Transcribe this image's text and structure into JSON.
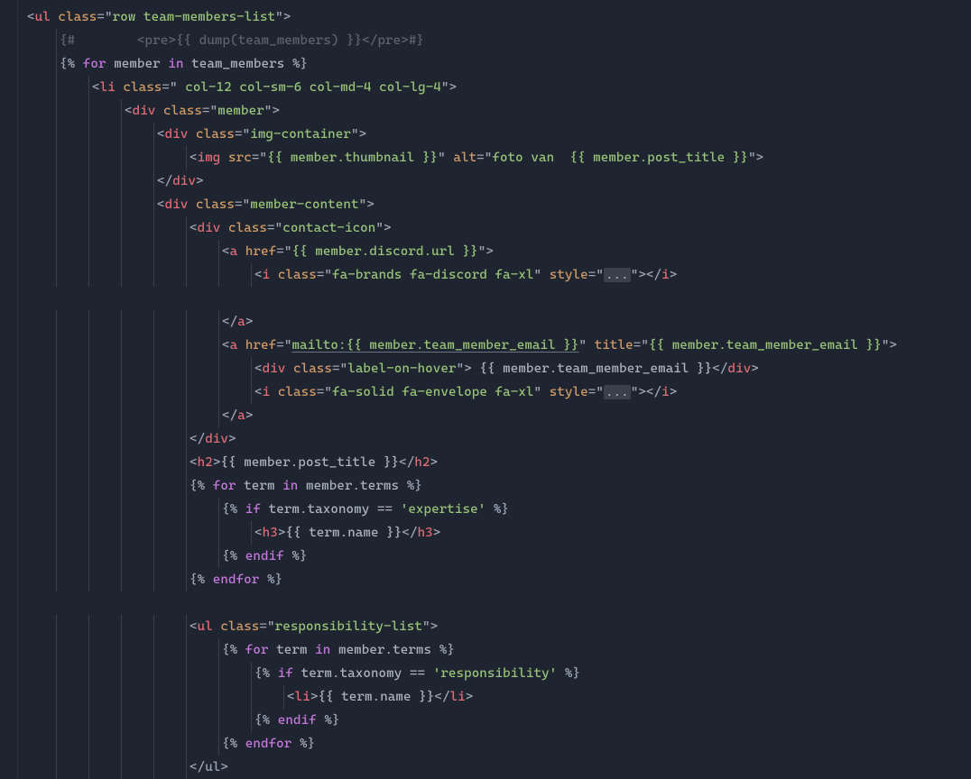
{
  "lines": [
    {
      "indent": 0,
      "tokens": [
        {
          "cls": "punct",
          "t": "<"
        },
        {
          "cls": "tag",
          "t": "ul"
        },
        {
          "cls": "punct",
          "t": " "
        },
        {
          "cls": "attr",
          "t": "class"
        },
        {
          "cls": "punct",
          "t": "="
        },
        {
          "cls": "punct",
          "t": "\""
        },
        {
          "cls": "string",
          "t": "row team-members-list"
        },
        {
          "cls": "punct",
          "t": "\""
        },
        {
          "cls": "punct",
          "t": ">"
        }
      ]
    },
    {
      "indent": 1,
      "tokens": [
        {
          "cls": "comment",
          "t": "{#        <pre>{{ dump(team_members) }}</pre>#}"
        }
      ]
    },
    {
      "indent": 1,
      "tokens": [
        {
          "cls": "punct",
          "t": "{% "
        },
        {
          "cls": "kw",
          "t": "for"
        },
        {
          "cls": "var",
          "t": " member "
        },
        {
          "cls": "kw",
          "t": "in"
        },
        {
          "cls": "var",
          "t": " team_members "
        },
        {
          "cls": "punct",
          "t": "%}"
        }
      ]
    },
    {
      "indent": 2,
      "tokens": [
        {
          "cls": "punct",
          "t": "<"
        },
        {
          "cls": "tag",
          "t": "li"
        },
        {
          "cls": "punct",
          "t": " "
        },
        {
          "cls": "attr",
          "t": "class"
        },
        {
          "cls": "punct",
          "t": "="
        },
        {
          "cls": "punct",
          "t": "\""
        },
        {
          "cls": "string",
          "t": " col-12 col-sm-6 col-md-4 col-lg-4"
        },
        {
          "cls": "punct",
          "t": "\""
        },
        {
          "cls": "punct",
          "t": ">"
        }
      ]
    },
    {
      "indent": 3,
      "tokens": [
        {
          "cls": "punct",
          "t": "<"
        },
        {
          "cls": "tag",
          "t": "div"
        },
        {
          "cls": "punct",
          "t": " "
        },
        {
          "cls": "attr",
          "t": "class"
        },
        {
          "cls": "punct",
          "t": "="
        },
        {
          "cls": "punct",
          "t": "\""
        },
        {
          "cls": "string",
          "t": "member"
        },
        {
          "cls": "punct",
          "t": "\""
        },
        {
          "cls": "punct",
          "t": ">"
        }
      ]
    },
    {
      "indent": 4,
      "tokens": [
        {
          "cls": "punct",
          "t": "<"
        },
        {
          "cls": "tag",
          "t": "div"
        },
        {
          "cls": "punct",
          "t": " "
        },
        {
          "cls": "attr",
          "t": "class"
        },
        {
          "cls": "punct",
          "t": "="
        },
        {
          "cls": "punct",
          "t": "\""
        },
        {
          "cls": "string",
          "t": "img-container"
        },
        {
          "cls": "punct",
          "t": "\""
        },
        {
          "cls": "punct",
          "t": ">"
        }
      ]
    },
    {
      "indent": 5,
      "tokens": [
        {
          "cls": "punct",
          "t": "<"
        },
        {
          "cls": "tag",
          "t": "img"
        },
        {
          "cls": "punct",
          "t": " "
        },
        {
          "cls": "attr",
          "t": "src"
        },
        {
          "cls": "punct",
          "t": "="
        },
        {
          "cls": "punct",
          "t": "\""
        },
        {
          "cls": "string",
          "t": "{{ member.thumbnail }}"
        },
        {
          "cls": "punct",
          "t": "\""
        },
        {
          "cls": "punct",
          "t": " "
        },
        {
          "cls": "attr",
          "t": "alt"
        },
        {
          "cls": "punct",
          "t": "="
        },
        {
          "cls": "punct",
          "t": "\""
        },
        {
          "cls": "string",
          "t": "foto van  {{ member.post_title }}"
        },
        {
          "cls": "punct",
          "t": "\""
        },
        {
          "cls": "punct",
          "t": ">"
        }
      ]
    },
    {
      "indent": 4,
      "tokens": [
        {
          "cls": "punct",
          "t": "</"
        },
        {
          "cls": "tag",
          "t": "div"
        },
        {
          "cls": "punct",
          "t": ">"
        }
      ]
    },
    {
      "indent": 4,
      "tokens": [
        {
          "cls": "punct",
          "t": "<"
        },
        {
          "cls": "tag",
          "t": "div"
        },
        {
          "cls": "punct",
          "t": " "
        },
        {
          "cls": "attr",
          "t": "class"
        },
        {
          "cls": "punct",
          "t": "="
        },
        {
          "cls": "punct",
          "t": "\""
        },
        {
          "cls": "string",
          "t": "member-content"
        },
        {
          "cls": "punct",
          "t": "\""
        },
        {
          "cls": "punct",
          "t": ">"
        }
      ]
    },
    {
      "indent": 5,
      "tokens": [
        {
          "cls": "punct",
          "t": "<"
        },
        {
          "cls": "tag",
          "t": "div"
        },
        {
          "cls": "punct",
          "t": " "
        },
        {
          "cls": "attr",
          "t": "class"
        },
        {
          "cls": "punct",
          "t": "="
        },
        {
          "cls": "punct",
          "t": "\""
        },
        {
          "cls": "string",
          "t": "contact-icon"
        },
        {
          "cls": "punct",
          "t": "\""
        },
        {
          "cls": "punct",
          "t": ">"
        }
      ]
    },
    {
      "indent": 6,
      "tokens": [
        {
          "cls": "punct",
          "t": "<"
        },
        {
          "cls": "tag",
          "t": "a"
        },
        {
          "cls": "punct",
          "t": " "
        },
        {
          "cls": "attr",
          "t": "href"
        },
        {
          "cls": "punct",
          "t": "="
        },
        {
          "cls": "punct",
          "t": "\""
        },
        {
          "cls": "string",
          "t": "{{ member.discord.url }}"
        },
        {
          "cls": "punct",
          "t": "\""
        },
        {
          "cls": "punct",
          "t": ">"
        }
      ]
    },
    {
      "indent": 7,
      "tokens": [
        {
          "cls": "punct",
          "t": "<"
        },
        {
          "cls": "tag",
          "t": "i"
        },
        {
          "cls": "punct",
          "t": " "
        },
        {
          "cls": "attr",
          "t": "class"
        },
        {
          "cls": "punct",
          "t": "="
        },
        {
          "cls": "punct",
          "t": "\""
        },
        {
          "cls": "string",
          "t": "fa-brands fa-discord fa-xl"
        },
        {
          "cls": "punct",
          "t": "\""
        },
        {
          "cls": "punct",
          "t": " "
        },
        {
          "cls": "attr",
          "t": "style"
        },
        {
          "cls": "punct",
          "t": "="
        },
        {
          "cls": "punct",
          "t": "\""
        },
        {
          "cls": "folded",
          "t": "..."
        },
        {
          "cls": "punct",
          "t": "\""
        },
        {
          "cls": "punct",
          "t": "></"
        },
        {
          "cls": "tag",
          "t": "i"
        },
        {
          "cls": "punct",
          "t": ">"
        }
      ]
    },
    {
      "indent": 0,
      "tokens": []
    },
    {
      "indent": 6,
      "tokens": [
        {
          "cls": "punct",
          "t": "</"
        },
        {
          "cls": "tag",
          "t": "a"
        },
        {
          "cls": "punct",
          "t": ">"
        }
      ]
    },
    {
      "indent": 6,
      "tokens": [
        {
          "cls": "punct",
          "t": "<"
        },
        {
          "cls": "tag",
          "t": "a"
        },
        {
          "cls": "punct",
          "t": " "
        },
        {
          "cls": "attr",
          "t": "href"
        },
        {
          "cls": "punct",
          "t": "="
        },
        {
          "cls": "punct",
          "t": "\""
        },
        {
          "cls": "string underline",
          "t": "mailto:{{ member.team_member_email }}"
        },
        {
          "cls": "punct",
          "t": "\""
        },
        {
          "cls": "punct",
          "t": " "
        },
        {
          "cls": "attr",
          "t": "title"
        },
        {
          "cls": "punct",
          "t": "="
        },
        {
          "cls": "punct",
          "t": "\""
        },
        {
          "cls": "string",
          "t": "{{ member.team_member_email }}"
        },
        {
          "cls": "punct",
          "t": "\""
        },
        {
          "cls": "punct",
          "t": ">"
        }
      ]
    },
    {
      "indent": 7,
      "tokens": [
        {
          "cls": "punct",
          "t": "<"
        },
        {
          "cls": "tag",
          "t": "div"
        },
        {
          "cls": "punct",
          "t": " "
        },
        {
          "cls": "attr",
          "t": "class"
        },
        {
          "cls": "punct",
          "t": "="
        },
        {
          "cls": "punct",
          "t": "\""
        },
        {
          "cls": "string",
          "t": "label-on-hover"
        },
        {
          "cls": "punct",
          "t": "\""
        },
        {
          "cls": "punct",
          "t": ">"
        },
        {
          "cls": "var",
          "t": " {{ member.team_member_email }}"
        },
        {
          "cls": "punct",
          "t": "</"
        },
        {
          "cls": "tag",
          "t": "div"
        },
        {
          "cls": "punct",
          "t": ">"
        }
      ]
    },
    {
      "indent": 7,
      "tokens": [
        {
          "cls": "punct",
          "t": "<"
        },
        {
          "cls": "tag",
          "t": "i"
        },
        {
          "cls": "punct",
          "t": " "
        },
        {
          "cls": "attr",
          "t": "class"
        },
        {
          "cls": "punct",
          "t": "="
        },
        {
          "cls": "punct",
          "t": "\""
        },
        {
          "cls": "string",
          "t": "fa-solid fa-envelope fa-xl"
        },
        {
          "cls": "punct",
          "t": "\""
        },
        {
          "cls": "punct",
          "t": " "
        },
        {
          "cls": "attr",
          "t": "style"
        },
        {
          "cls": "punct",
          "t": "="
        },
        {
          "cls": "punct",
          "t": "\""
        },
        {
          "cls": "folded",
          "t": "..."
        },
        {
          "cls": "punct",
          "t": "\""
        },
        {
          "cls": "punct",
          "t": "></"
        },
        {
          "cls": "tag",
          "t": "i"
        },
        {
          "cls": "punct",
          "t": ">"
        }
      ]
    },
    {
      "indent": 6,
      "tokens": [
        {
          "cls": "punct",
          "t": "</"
        },
        {
          "cls": "tag",
          "t": "a"
        },
        {
          "cls": "punct",
          "t": ">"
        }
      ]
    },
    {
      "indent": 5,
      "tokens": [
        {
          "cls": "punct",
          "t": "</"
        },
        {
          "cls": "tag",
          "t": "div"
        },
        {
          "cls": "punct",
          "t": ">"
        }
      ]
    },
    {
      "indent": 5,
      "tokens": [
        {
          "cls": "punct",
          "t": "<"
        },
        {
          "cls": "tag",
          "t": "h2"
        },
        {
          "cls": "punct",
          "t": ">"
        },
        {
          "cls": "var",
          "t": "{{ member.post_title }}"
        },
        {
          "cls": "punct",
          "t": "</"
        },
        {
          "cls": "tag",
          "t": "h2"
        },
        {
          "cls": "punct",
          "t": ">"
        }
      ]
    },
    {
      "indent": 5,
      "tokens": [
        {
          "cls": "punct",
          "t": "{% "
        },
        {
          "cls": "kw",
          "t": "for"
        },
        {
          "cls": "var",
          "t": " term "
        },
        {
          "cls": "kw",
          "t": "in"
        },
        {
          "cls": "var",
          "t": " member.terms "
        },
        {
          "cls": "punct",
          "t": "%}"
        }
      ]
    },
    {
      "indent": 6,
      "tokens": [
        {
          "cls": "punct",
          "t": "{% "
        },
        {
          "cls": "kw",
          "t": "if"
        },
        {
          "cls": "var",
          "t": " term.taxonomy == "
        },
        {
          "cls": "str-single",
          "t": "'expertise'"
        },
        {
          "cls": "var",
          "t": " "
        },
        {
          "cls": "punct",
          "t": "%}"
        }
      ]
    },
    {
      "indent": 7,
      "tokens": [
        {
          "cls": "punct",
          "t": "<"
        },
        {
          "cls": "tag",
          "t": "h3"
        },
        {
          "cls": "punct",
          "t": ">"
        },
        {
          "cls": "var",
          "t": "{{ term.name }}"
        },
        {
          "cls": "punct",
          "t": "</"
        },
        {
          "cls": "tag",
          "t": "h3"
        },
        {
          "cls": "punct",
          "t": ">"
        }
      ]
    },
    {
      "indent": 6,
      "tokens": [
        {
          "cls": "punct",
          "t": "{% "
        },
        {
          "cls": "kw",
          "t": "endif"
        },
        {
          "cls": "var",
          "t": " "
        },
        {
          "cls": "punct",
          "t": "%}"
        }
      ]
    },
    {
      "indent": 5,
      "tokens": [
        {
          "cls": "punct",
          "t": "{% "
        },
        {
          "cls": "kw",
          "t": "endfor"
        },
        {
          "cls": "var",
          "t": " "
        },
        {
          "cls": "punct",
          "t": "%}"
        }
      ]
    },
    {
      "indent": 0,
      "tokens": []
    },
    {
      "indent": 5,
      "tokens": [
        {
          "cls": "punct",
          "t": "<"
        },
        {
          "cls": "tag",
          "t": "ul"
        },
        {
          "cls": "punct",
          "t": " "
        },
        {
          "cls": "attr",
          "t": "class"
        },
        {
          "cls": "punct",
          "t": "="
        },
        {
          "cls": "punct",
          "t": "\""
        },
        {
          "cls": "string",
          "t": "responsibility-list"
        },
        {
          "cls": "punct",
          "t": "\""
        },
        {
          "cls": "punct",
          "t": ">"
        }
      ]
    },
    {
      "indent": 6,
      "tokens": [
        {
          "cls": "punct",
          "t": "{% "
        },
        {
          "cls": "kw",
          "t": "for"
        },
        {
          "cls": "var",
          "t": " term "
        },
        {
          "cls": "kw",
          "t": "in"
        },
        {
          "cls": "var",
          "t": " member.terms "
        },
        {
          "cls": "punct",
          "t": "%}"
        }
      ]
    },
    {
      "indent": 7,
      "tokens": [
        {
          "cls": "punct",
          "t": "{% "
        },
        {
          "cls": "kw",
          "t": "if"
        },
        {
          "cls": "var",
          "t": " term.taxonomy == "
        },
        {
          "cls": "str-single",
          "t": "'responsibility'"
        },
        {
          "cls": "var",
          "t": " "
        },
        {
          "cls": "punct",
          "t": "%}"
        }
      ]
    },
    {
      "indent": 8,
      "tokens": [
        {
          "cls": "punct",
          "t": "<"
        },
        {
          "cls": "tag",
          "t": "li"
        },
        {
          "cls": "punct",
          "t": ">"
        },
        {
          "cls": "var",
          "t": "{{ term.name }}"
        },
        {
          "cls": "punct",
          "t": "</"
        },
        {
          "cls": "tag",
          "t": "li"
        },
        {
          "cls": "punct",
          "t": ">"
        }
      ]
    },
    {
      "indent": 7,
      "tokens": [
        {
          "cls": "punct",
          "t": "{% "
        },
        {
          "cls": "kw",
          "t": "endif"
        },
        {
          "cls": "var",
          "t": " "
        },
        {
          "cls": "punct",
          "t": "%}"
        }
      ]
    },
    {
      "indent": 6,
      "tokens": [
        {
          "cls": "punct",
          "t": "{% "
        },
        {
          "cls": "kw",
          "t": "endfor"
        },
        {
          "cls": "var",
          "t": " "
        },
        {
          "cls": "punct",
          "t": "%}"
        }
      ]
    },
    {
      "indent": 5,
      "tokens": [
        {
          "cls": "punct dim",
          "t": "</"
        },
        {
          "cls": "tag dim",
          "t": "ul"
        },
        {
          "cls": "punct dim",
          "t": ">"
        }
      ]
    }
  ],
  "indentWidth": 36
}
